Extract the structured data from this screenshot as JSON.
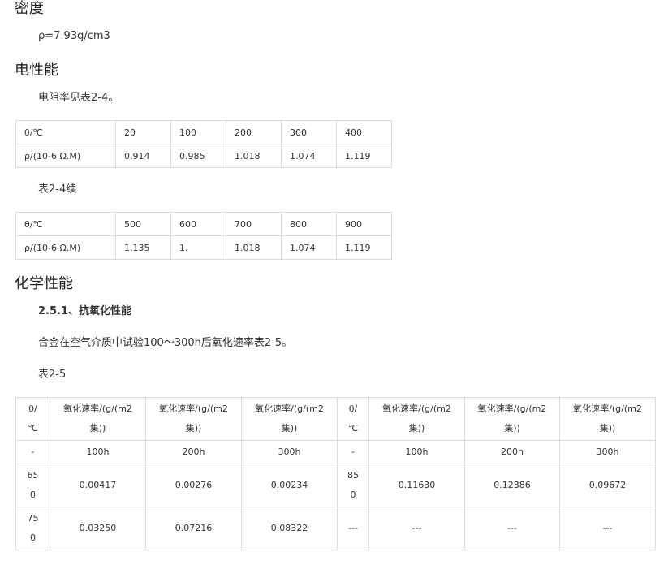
{
  "density": {
    "heading": "密度",
    "value": "ρ=7.93g/cm3"
  },
  "electrical": {
    "heading": "电性能",
    "intro": "电阻率见表2-4。",
    "table1": {
      "rows": [
        [
          "θ/℃",
          "20",
          "100",
          "200",
          "300",
          "400"
        ],
        [
          "ρ/(10-6 Ω.M)",
          "0.914",
          "0.985",
          "1.018",
          "1.074",
          "1.119"
        ]
      ]
    },
    "table_cont_caption": "表2-4续",
    "table2": {
      "rows": [
        [
          "θ/℃",
          "500",
          "600",
          "700",
          "800",
          "900"
        ],
        [
          "ρ/(10-6 Ω.M)",
          "1.135",
          "1.",
          "1.018",
          "1.074",
          "1.119"
        ]
      ]
    }
  },
  "chemical": {
    "heading": "化学性能",
    "subheading": "2.5.1、抗氧化性能",
    "intro": "合金在空气介质中试验100～300h后氧化速率表2-5。",
    "table_caption": "表2-5",
    "table": {
      "header": {
        "theta_top": "θ/",
        "theta_bottom": "℃",
        "rate_top": "氧化速率/(g/(m2",
        "rate_bottom": "集))"
      },
      "hours_row": [
        "-",
        "100h",
        "200h",
        "300h",
        "-",
        "100h",
        "200h",
        "300h"
      ],
      "rows": [
        {
          "t1_top": "65",
          "t1_bottom": "0",
          "a": "0.00417",
          "b": "0.00276",
          "c": "0.00234",
          "t2_top": "85",
          "t2_bottom": "0",
          "d": "0.11630",
          "e": "0.12386",
          "f": "0.09672"
        },
        {
          "t1_top": "75",
          "t1_bottom": "0",
          "a": "0.03250",
          "b": "0.07216",
          "c": "0.08322",
          "t2_top": "---",
          "t2_bottom": "",
          "d": "---",
          "e": "---",
          "f": "---"
        }
      ]
    }
  }
}
